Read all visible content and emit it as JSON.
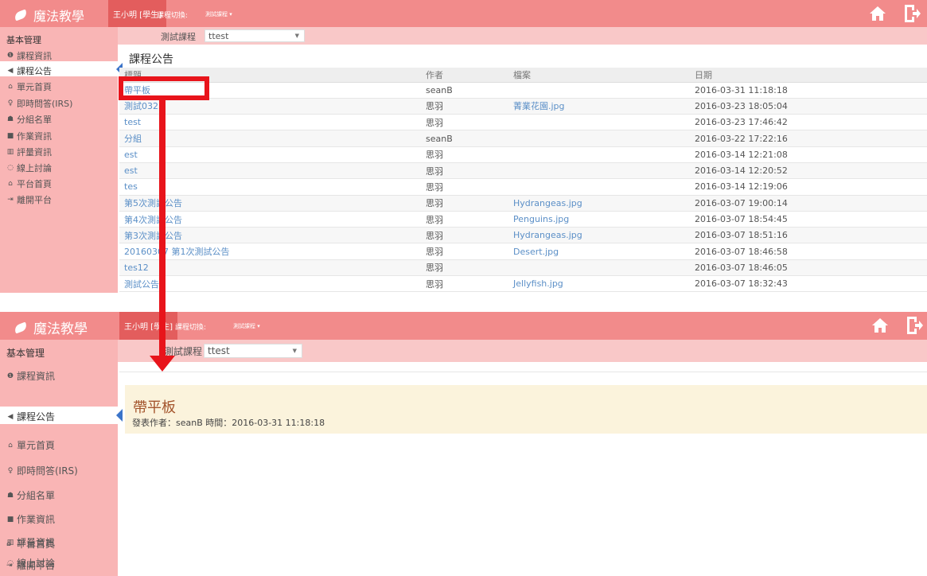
{
  "app": {
    "brand": "魔法教學",
    "user_a": "王小明 [學生]",
    "user_b": "王小明 [學生]",
    "switch_label": "課程切換:",
    "current_course_menu": "測試課程 ▾"
  },
  "course_select": {
    "label": "測試課程",
    "value": "ttest"
  },
  "sidebar": {
    "header": "基本管理",
    "items": [
      {
        "icon": "info-icon",
        "glyph": "❶",
        "label": "課程資訊"
      },
      {
        "icon": "megaphone-icon",
        "glyph": "◀",
        "label": "課程公告",
        "active": true
      },
      {
        "icon": "home-icon",
        "glyph": "⌂",
        "label": "單元首頁"
      },
      {
        "icon": "lightbulb-icon",
        "glyph": "♀",
        "label": "即時問答(IRS)"
      },
      {
        "icon": "group-icon",
        "glyph": "☗",
        "label": "分組名單"
      },
      {
        "icon": "book-icon",
        "glyph": "■",
        "label": "作業資訊"
      },
      {
        "icon": "chart-icon",
        "glyph": "▥",
        "label": "評量資訊"
      },
      {
        "icon": "chat-icon",
        "glyph": "◌",
        "label": "線上討論"
      },
      {
        "icon": "platform-home-icon",
        "glyph": "⌂",
        "label": "平台首頁"
      },
      {
        "icon": "exit-icon",
        "glyph": "⇥",
        "label": "離開平台"
      }
    ]
  },
  "announcements": {
    "title": "課程公告",
    "columns": [
      "標題",
      "作者",
      "檔案",
      "日期"
    ],
    "rows": [
      {
        "title": "帶平板",
        "author": "seanB",
        "file": "",
        "date": "2016-03-31 11:18:18"
      },
      {
        "title": "測試0323",
        "author": "思羽",
        "file": "菁業花園.jpg",
        "date": "2016-03-23 18:05:04"
      },
      {
        "title": "test",
        "author": "思羽",
        "file": "",
        "date": "2016-03-23 17:46:42"
      },
      {
        "title": "分組",
        "author": "seanB",
        "file": "",
        "date": "2016-03-22 17:22:16"
      },
      {
        "title": "est",
        "author": "思羽",
        "file": "",
        "date": "2016-03-14 12:21:08"
      },
      {
        "title": "est",
        "author": "思羽",
        "file": "",
        "date": "2016-03-14 12:20:52"
      },
      {
        "title": "tes",
        "author": "思羽",
        "file": "",
        "date": "2016-03-14 12:19:06"
      },
      {
        "title": "第5次測試公告",
        "author": "思羽",
        "file": "Hydrangeas.jpg",
        "date": "2016-03-07 19:00:14"
      },
      {
        "title": "第4次測試公告",
        "author": "思羽",
        "file": "Penguins.jpg",
        "date": "2016-03-07 18:54:45"
      },
      {
        "title": "第3次測試公告",
        "author": "思羽",
        "file": "Hydrangeas.jpg",
        "date": "2016-03-07 18:51:16"
      },
      {
        "title": "20160307 第1次測試公告",
        "author": "思羽",
        "file": "Desert.jpg",
        "date": "2016-03-07 18:46:58"
      },
      {
        "title": "tes12",
        "author": "思羽",
        "file": "",
        "date": "2016-03-07 18:46:05"
      },
      {
        "title": "測試公告",
        "author": "思羽",
        "file": "Jellyfish.jpg",
        "date": "2016-03-07 18:32:43"
      }
    ]
  },
  "detail": {
    "title": "帶平板",
    "meta": "發表作者：seanB  時間：2016-03-31 11:18:18"
  },
  "colors": {
    "topbar": "#f28b8b",
    "sidebar": "#f9b5b5",
    "highlight": "#e8141b",
    "detail_bg": "#fbf3dc"
  }
}
